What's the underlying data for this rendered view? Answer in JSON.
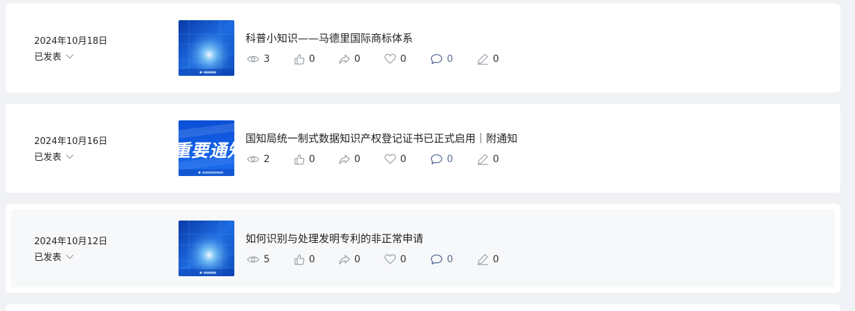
{
  "articles": [
    {
      "date": "2024年10月18日",
      "status": "已发表",
      "title": "科普小知识——马德里国际商标体系",
      "stats": {
        "views": "3",
        "likes": "0",
        "shares": "0",
        "favorites": "0",
        "comments": "0",
        "edits": "0"
      },
      "thumbnail": "blue-tech-light"
    },
    {
      "date": "2024年10月16日",
      "status": "已发表",
      "title": "国知局统一制式数据知识产权登记证书已正式启用｜附通知",
      "stats": {
        "views": "2",
        "likes": "0",
        "shares": "0",
        "favorites": "0",
        "comments": "0",
        "edits": "0"
      },
      "thumbnail": "important-notice",
      "thumbnail_text": "重要通知"
    },
    {
      "date": "2024年10月12日",
      "status": "已发表",
      "title": "如何识别与处理发明专利的非正常申请",
      "stats": {
        "views": "5",
        "likes": "0",
        "shares": "0",
        "favorites": "0",
        "comments": "0",
        "edits": "0"
      },
      "thumbnail": "blue-tech-light"
    }
  ],
  "icons": {
    "views": "eye-icon",
    "likes": "thumbs-up-icon",
    "shares": "share-arrow-icon",
    "favorites": "heart-icon",
    "comments": "comment-icon",
    "edits": "pen-icon",
    "status": "chevron-down-icon"
  },
  "colors": {
    "background": "#f0f2f5",
    "card": "#ffffff",
    "hover_card": "#f7f8fa",
    "icon": "#9aa0a6",
    "comment_icon": "#586c94"
  }
}
